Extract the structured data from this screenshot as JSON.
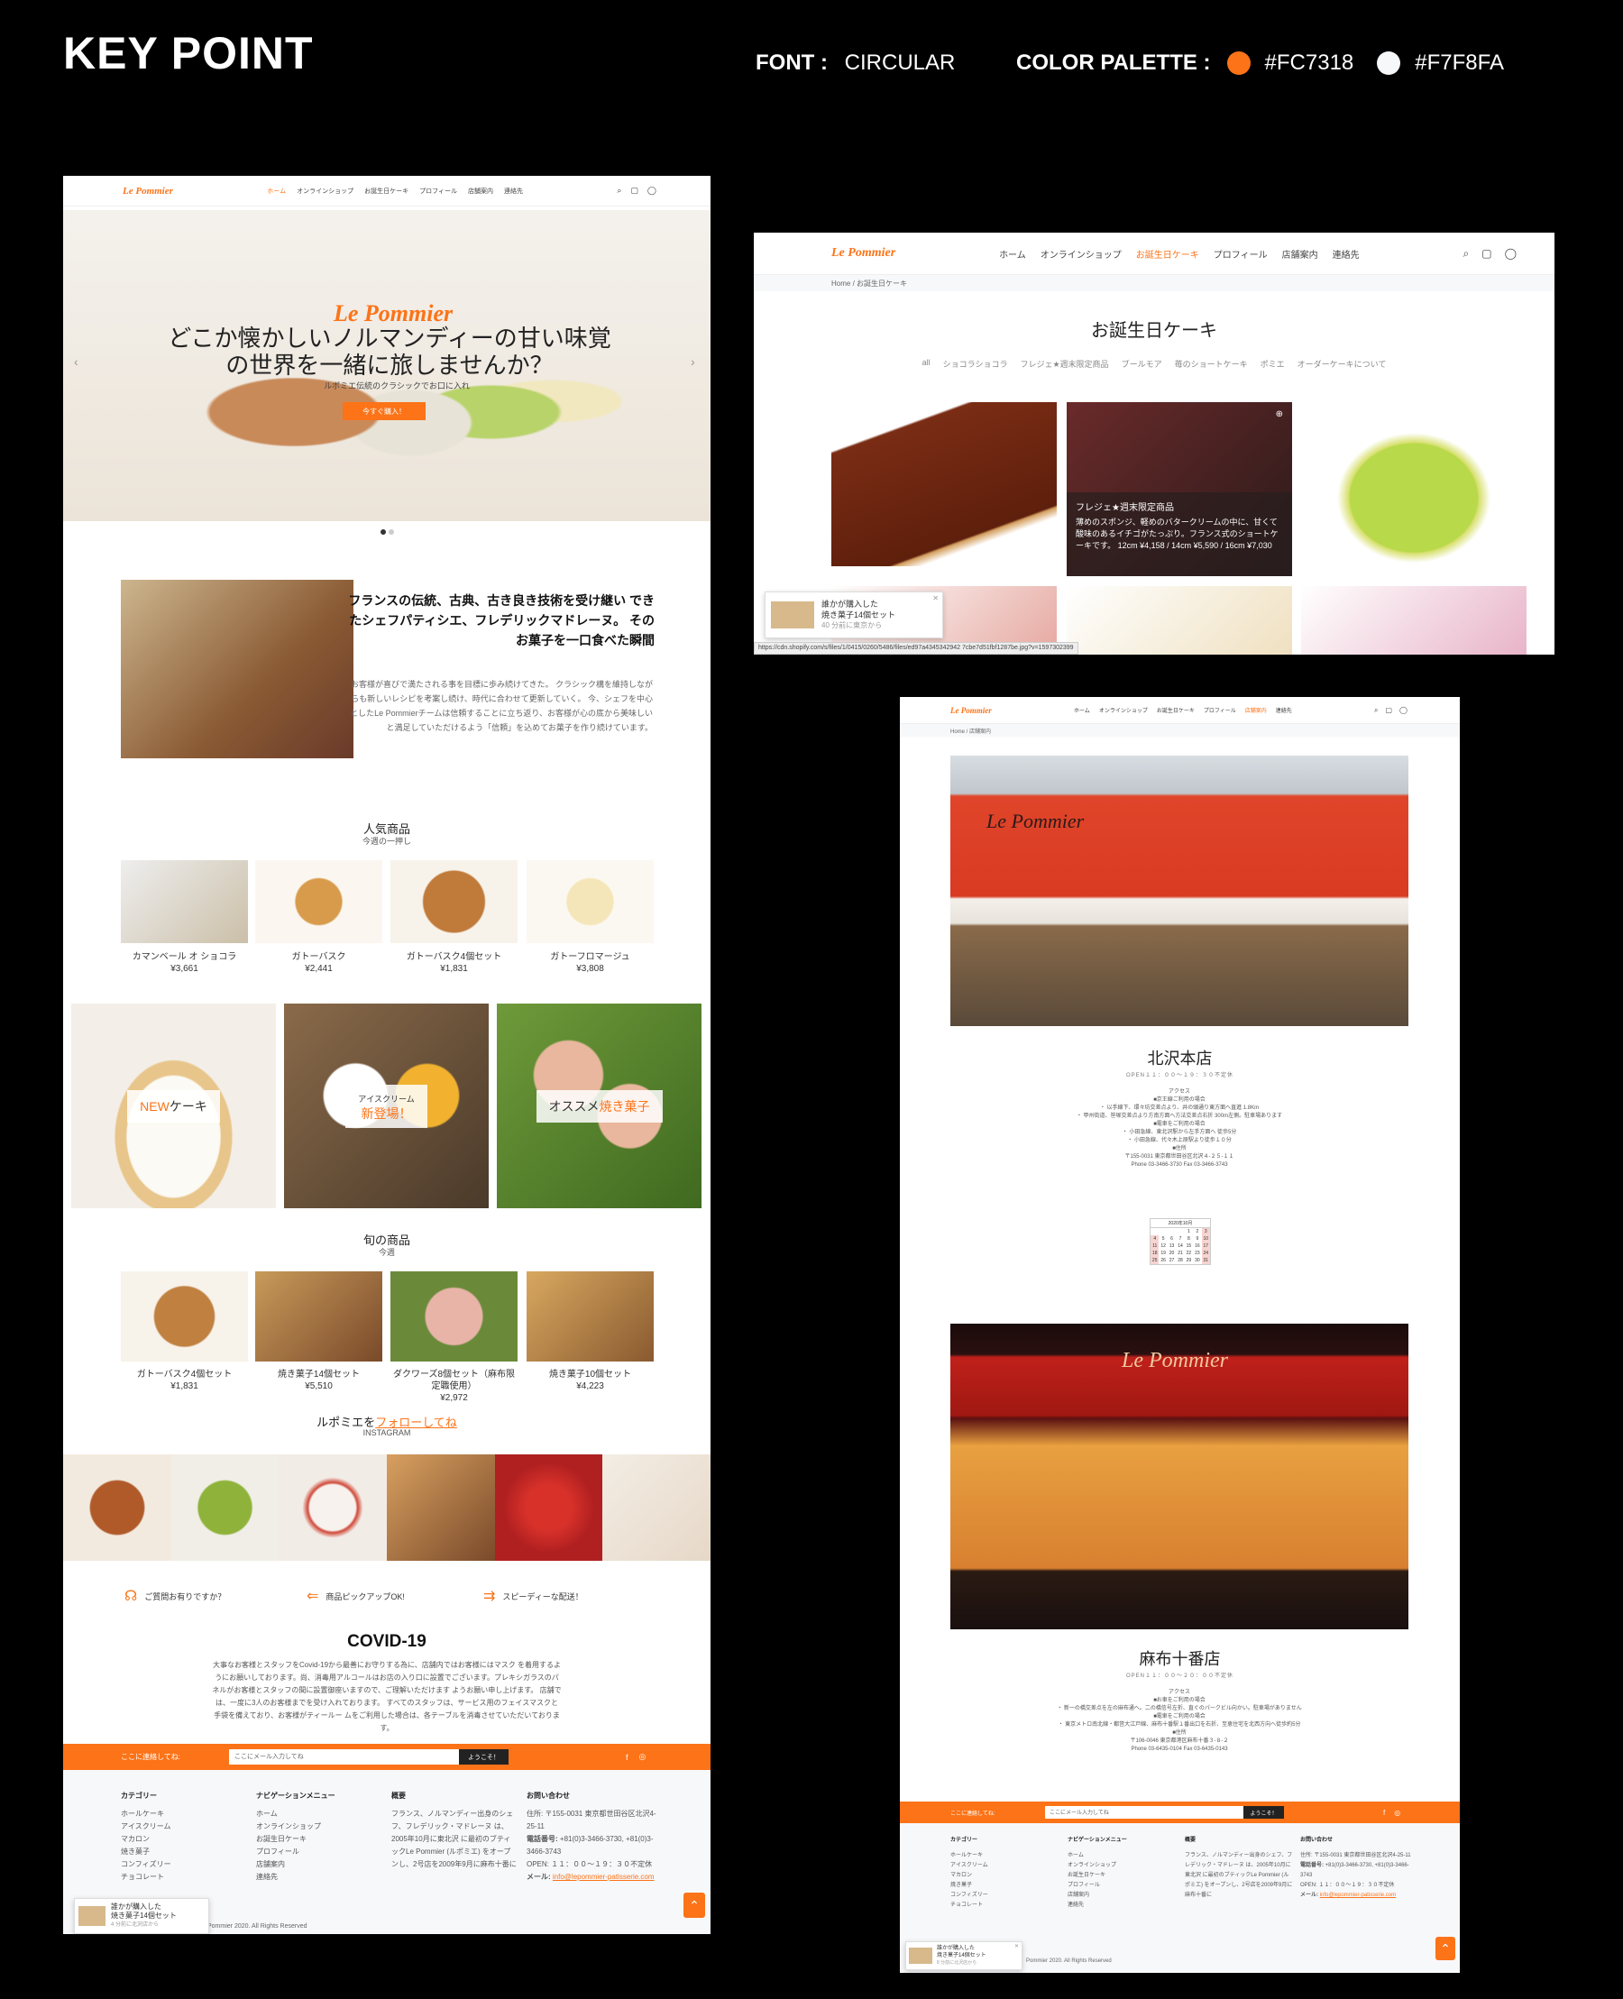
{
  "header": {
    "title": "KEY POINT",
    "font_label": "FONT :",
    "font_value": "CIRCULAR",
    "palette_label": "COLOR PALETTE :",
    "palette": [
      {
        "hex": "#FC7318",
        "label": "#FC7318"
      },
      {
        "hex": "#F7F8FA",
        "label": "#F7F8FA"
      }
    ]
  },
  "site": {
    "logo": "Le Pommier",
    "nav": [
      "ホーム",
      "オンラインショップ",
      "お誕生日ケーキ",
      "プロフィール",
      "店舗案内",
      "連絡先"
    ],
    "icons": [
      "search-icon",
      "cart-icon",
      "user-icon"
    ]
  },
  "home": {
    "hero_title": "どこか懐かしいノルマンディーの甘い味覚の世界を一緒に旅しませんか？",
    "hero_sub": "ルポミエ伝統のクラシックでお口に入れ",
    "hero_button": "今すぐ購入！",
    "intro_title": "フランスの伝統、古典、古き良き技術を受け継い できたシェフパティシエ、フレデリックマドレーヌ。 そのお菓子を一口食べた瞬間",
    "intro_text": "お客様が喜びで満たされる事を目標に歩み続けてきた。 クラシック構を維持しながらも新しいレシピを考案し続け、時代に合わせて更新していく。 今、シェフを中心としたLe Pommierチームは信頼することに立ち返り、お客様が心の底から美味しいと満足していただけるよう「信頼」を込めてお菓子を作り続けています。",
    "popular_title": "人気商品",
    "popular_sub": "今週の一押し",
    "popular": [
      {
        "name": "カマンベール オ ショコラ",
        "price": "¥3,661"
      },
      {
        "name": "ガトーバスク",
        "price": "¥2,441"
      },
      {
        "name": "ガトーバスク4個セット",
        "price": "¥1,831"
      },
      {
        "name": "ガトーフロマージュ",
        "price": "¥3,808"
      }
    ],
    "tiles": [
      {
        "pre": "NEW",
        "text": "ケーキ",
        "sub": ""
      },
      {
        "pre": "アイスクリーム",
        "text": "新登場！",
        "sub": ""
      },
      {
        "pre": "オススメ",
        "text": "焼き菓子",
        "sub": ""
      }
    ],
    "season_title": "旬の商品",
    "season_sub": "今週",
    "season": [
      {
        "name": "ガトーバスク4個セット",
        "price": "¥1,831"
      },
      {
        "name": "焼き菓子14個セット",
        "price": "¥5,510"
      },
      {
        "name": "ダクワーズ8個セット（麻布限定職使用）",
        "price": "¥2,972"
      },
      {
        "name": "焼き菓子10個セット",
        "price": "¥4,223"
      }
    ],
    "follow_pre": "ルポミエを",
    "follow_link": "フォローしてね",
    "follow_sub": "INSTAGRAM",
    "features": [
      "ご質問お有りですか？",
      "商品ピックアップOK!",
      "スピーディーな配送！"
    ],
    "covid_title": "COVID-19",
    "covid_text": "大事なお客様とスタッフをCovid-19から最善にお守りする為に、店舗内ではお客様にはマスク を着用するようにお願いしております。尚、消毒用アルコールはお店の入り口に設置でございます。プレキシガラスのパネルがお客様とスタッフの間に設置御座いますので、ご理解いただけます ようお願い申し上げます。 店舗では、一度に3人のお客様までを受け入れております。 すべてのスタッフは、サービス用のフェイスマスクと手袋を備えており、お客様がティールー ムをご利用した場合は、各テーブルを消毒させていただいております。",
    "newsletter_label": "ここに連絡してね:",
    "newsletter_placeholder": "ここにメール入力してね",
    "newsletter_button": "ようこそ！",
    "footer": {
      "cat_title": "カテゴリー",
      "cats": [
        "ホールケーキ",
        "アイスクリーム",
        "マカロン",
        "焼き菓子",
        "コンフィズリー",
        "チョコレート"
      ],
      "nav_title": "ナビゲーションメニュー",
      "navs": [
        "ホーム",
        "オンラインショップ",
        "お誕生日ケーキ",
        "プロフィール",
        "店舗案内",
        "連絡先"
      ],
      "about_title": "概要",
      "about": "フランス、ノルマンディー出身のシェフ、フレデリック・マドレーヌ は、2005年10月に東北沢 に最初のブティックLe Pommier (ルポミエ) をオープンし、2号店を2009年9月に麻布十番に",
      "contact_title": "お問い合わせ",
      "address": "住所: 〒155-0031 東京都世田谷区北沢4-25-11",
      "phone_label": "電話番号:",
      "phone": "+81(0)3-3466-3730, +81(0)3-3466-3743",
      "open": "OPEN: １１：００～１９：３０不定休",
      "mail_label": "メール:",
      "mail": "info@lepommier-patisserie.com"
    },
    "copyright": "Pommier 2020. All Rights Reserved",
    "toast_line1": "誰かが購入した",
    "toast_line2": "焼き菓子14個セット",
    "toast_line3": "4 分前に北沢店から"
  },
  "birthday": {
    "crumb": "Home / お誕生日ケーキ",
    "title": "お誕生日ケーキ",
    "filters": [
      "all",
      "ショコラショコラ",
      "フレジェ★週末限定商品",
      "ブールモア",
      "苺のショートケーキ",
      "ポミエ",
      "オーダーケーキについて"
    ],
    "hover_title": "フレジェ★週末限定商品",
    "hover_text": "薄めのスポンジ、軽めのバタークリームの中に、甘くて酸味のあるイチゴがたっぷり。フランス式のショートケーキです。 12cm ¥4,158 / 14cm ¥5,590 / 16cm ¥7,030",
    "toast_line1": "誰かが購入した",
    "toast_line2": "焼き菓子14個セット",
    "toast_line3": "40 分前に東京から",
    "status_url": "https://cdn.shopify.com/s/files/1/0415/0260/5486/files/ed97a4345342942 7cbe7d51fbf1287be.jpg?v=1597302399"
  },
  "stores": {
    "crumb": "Home / 店舗案内",
    "store1_name": "北沢本店",
    "store1_open": "OPEN１１：００～１９：３０不定休",
    "store1_access": "アクセス\n■京王線ご利用の場合\n・ 以手線下、環々坊交差点より、井の頭通り東方面へ直進 1.8Km\n・ 甲州街道、笹塚交差点より方南方面へ方法交差点右折 300m左側。駐車場あります\n■電車をご利用の場合\n・ 小田急線、東北沢駅から左手方面へ 徒歩5分\n・ 小田急線、代々木上原駅より徒歩１０分\n■住所\n〒155-0031 東京都世田谷区北沢４-２５-１１\nPhone 03-3466-3730 Fax 03-3466-3743",
    "calendar_title": "2020年10月",
    "calendar_days": [
      "1",
      "2",
      "3",
      "4",
      "5",
      "6",
      "7",
      "8",
      "9",
      "10",
      "11",
      "12",
      "13",
      "14",
      "15",
      "16",
      "17",
      "18",
      "19",
      "20",
      "21",
      "22",
      "23",
      "24",
      "25",
      "26",
      "27",
      "28",
      "29",
      "30",
      "31"
    ],
    "store2_name": "麻布十番店",
    "store2_open": "OPEN１１：００～２０：００不定休",
    "store2_access": "アクセス\n■お車をご利用の場合\n・ 新一の橋交差点を左の麻布通へ。二の橋信号左折、直ぐのパークビル向かい。駐車場がありません\n■電車をご利用の場合\n・ 東京メトロ南北線・都営大江戸線、麻布十番駅１番出口を右折、至恵住宅を北西方向へ徒歩約5分\n■住所\n〒106-0046 東京都港区麻布十番３-８-２\nPhone 03-6435-0104 Fax 03-6435-0143",
    "newsletter_label": "ここに連絡してね:",
    "newsletter_placeholder": "ここにメール入力してね",
    "newsletter_button": "ようこそ！",
    "copyright": "Pommier 2020. All Rights Reserved",
    "toast_line1": "誰かが購入した",
    "toast_line2": "焼き菓子14個セット",
    "toast_line3": "8 分前に北沢店から"
  }
}
